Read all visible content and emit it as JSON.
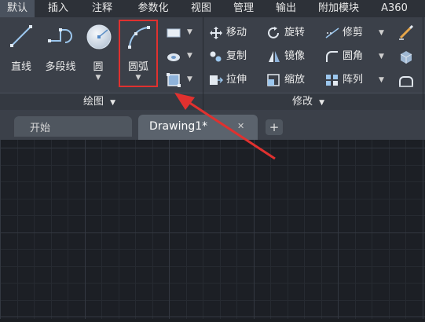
{
  "menu_tabs": [
    {
      "label": "默认"
    },
    {
      "label": "插入"
    },
    {
      "label": "注释"
    },
    {
      "label": "参数化"
    },
    {
      "label": "视图"
    },
    {
      "label": "管理"
    },
    {
      "label": "输出"
    },
    {
      "label": "附加模块"
    },
    {
      "label": "A360"
    }
  ],
  "draw_panel": {
    "title": "绘图",
    "line": "直线",
    "polyline": "多段线",
    "circle": "圆",
    "arc": "圆弧"
  },
  "modify_panel": {
    "title": "修改",
    "move": "移动",
    "rotate": "旋转",
    "trim": "修剪",
    "copy": "复制",
    "mirror": "镜像",
    "fillet": "圆角",
    "stretch": "拉伸",
    "scale": "缩放",
    "array": "阵列"
  },
  "file_tabs": {
    "start": "开始",
    "drawing": "Drawing1*",
    "close": "✕",
    "add": "+"
  },
  "colors": {
    "highlight": "#e0312f",
    "ribbon": "#3b4049",
    "canvas": "#1c1f25"
  }
}
